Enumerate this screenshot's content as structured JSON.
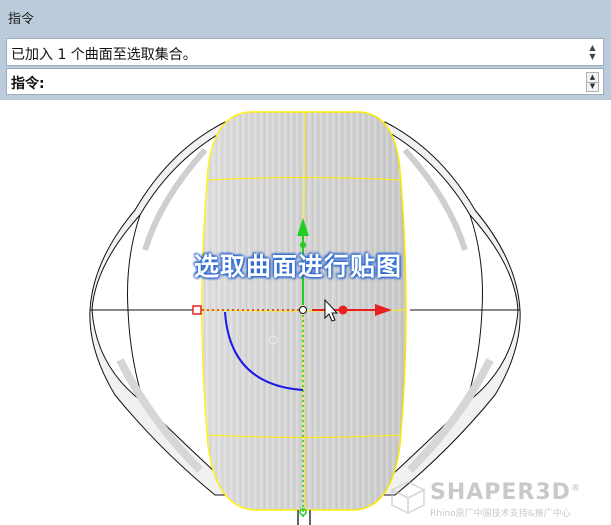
{
  "command_panel": {
    "title": "指令",
    "history_text": "已加入 1 个曲面至选取集合。",
    "prompt_label": "指令:"
  },
  "viewport": {
    "overlay_caption": "选取曲面进行贴图",
    "watermark": {
      "brand": "SHAPER3D",
      "registered_mark": "®",
      "subtitle": "Rhino原厂中国技术支持&推广中心"
    }
  },
  "colors": {
    "panel_bg": "#bccbdc",
    "selection_yellow": "#ffee00",
    "gumball_x_red": "#e82020",
    "gumball_y_green": "#22cc22",
    "arc_blue": "#1a1ae6",
    "caption_glow": "#2a6cdc"
  },
  "icons": [
    "scroll-up-icon",
    "scroll-down-icon",
    "spin-up-icon",
    "spin-down-icon",
    "shaper3d-logo-icon"
  ]
}
